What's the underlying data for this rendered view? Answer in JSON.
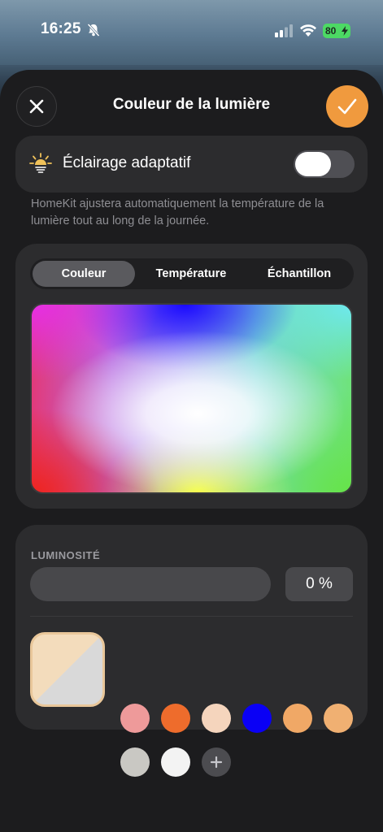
{
  "status_bar": {
    "time": "16:25",
    "battery": "80"
  },
  "header": {
    "title": "Couleur de la lumière"
  },
  "adaptive": {
    "label": "Éclairage adaptatif",
    "enabled": false,
    "description": "HomeKit ajustera automatiquement la température de la lumière tout au long de la journée."
  },
  "tabs": [
    {
      "label": "Couleur",
      "active": true
    },
    {
      "label": "Température",
      "active": false
    },
    {
      "label": "Échantillon",
      "active": false
    }
  ],
  "brightness": {
    "label": "LUMINOSITÉ",
    "value": "0 %",
    "level": 0
  },
  "presets": [
    {
      "color": "#ee9a9a"
    },
    {
      "color": "#ee6c2c"
    },
    {
      "color": "#f5d5bd"
    },
    {
      "color": "#0a00f5"
    },
    {
      "color": "#f0a866"
    },
    {
      "color": "#f0b072"
    },
    {
      "color": "#c9c8c3"
    },
    {
      "color": "#f3f3f3"
    }
  ],
  "accent_color": "#f09a3e"
}
